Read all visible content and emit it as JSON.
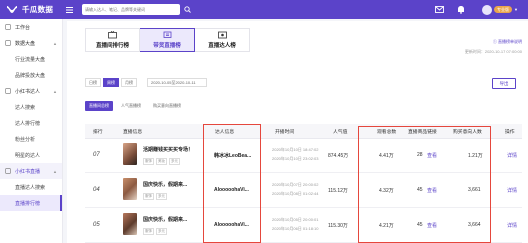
{
  "app": {
    "name": "千瓜数据"
  },
  "search": {
    "placeholder": "请输入达人、笔记、品牌等关键词"
  },
  "topbar": {
    "badge": "2",
    "vip_label": "专业版"
  },
  "sidebar": {
    "items": [
      {
        "type": "head",
        "label": "工作台",
        "icon": "home-icon"
      },
      {
        "type": "head",
        "label": "数据大盘",
        "icon": "dashboard-icon",
        "open": true
      },
      {
        "type": "item",
        "label": "行业流量大盘"
      },
      {
        "type": "item",
        "label": "品牌投放大盘"
      },
      {
        "type": "head",
        "label": "小红书达人",
        "icon": "user-icon",
        "open": true
      },
      {
        "type": "item",
        "label": "达人搜索"
      },
      {
        "type": "item",
        "label": "达人排行榜"
      },
      {
        "type": "item",
        "label": "粉丝分析"
      },
      {
        "type": "item",
        "label": "明星的达人"
      },
      {
        "type": "head",
        "label": "小红书直播",
        "icon": "live-icon",
        "open": true,
        "active": true
      },
      {
        "type": "item",
        "label": "直播达人搜索"
      },
      {
        "type": "item",
        "label": "直播排行榜",
        "active": true
      }
    ]
  },
  "tabs": [
    {
      "label": "直播间排行榜",
      "icon": "tv-icon",
      "active": false
    },
    {
      "label": "带货直播榜",
      "icon": "cart-icon",
      "active": true
    },
    {
      "label": "直播达人榜",
      "icon": "crown-icon",
      "active": false
    }
  ],
  "note": "① 直播榜单说明",
  "updated": "更新时间：2020-10-17 07:00:00",
  "filters": [
    {
      "label": "日榜",
      "active": false
    },
    {
      "label": "周榜",
      "active": true
    },
    {
      "label": "月榜",
      "active": false
    }
  ],
  "daterange": "2020-10-05至2020-10-11",
  "export_label": "导出",
  "subtabs": [
    {
      "label": "直播间总榜",
      "active": true
    },
    {
      "label": "人气直播榜",
      "active": false
    },
    {
      "label": "购买意向直播榜",
      "active": false
    }
  ],
  "table": {
    "headers": [
      "排行",
      "直播信息",
      "达人信息",
      "开播时间",
      "人气值",
      "观看总数",
      "直播商品链接",
      "购买意向人数",
      "操作"
    ],
    "rows": [
      {
        "rank": "07",
        "title": "活期赚钱买买买专场！",
        "tags": [
          "服饰",
          "美妆",
          "多元"
        ],
        "anchor": "韩冰冰LeoBea...",
        "time1": "2020年10月10日 18:47:02",
        "time2": "2020年10月10日 23:02:03",
        "popularity": "874.45万",
        "views": "4.41万",
        "goods_count": "28",
        "goods_link": "查看",
        "intent": "1.21万",
        "action": "详情"
      },
      {
        "rank": "04",
        "title": "国庆快乐，假期来...",
        "tags": [
          "服饰",
          "多元"
        ],
        "anchor": "AlooooohaVi...",
        "time1": "2020年10月07日 20:00:02",
        "time2": "2020年10月08日 01:02:44",
        "popularity": "115.12万",
        "views": "4.32万",
        "goods_count": "45",
        "goods_link": "查看",
        "intent": "3,661",
        "action": "详情"
      },
      {
        "rank": "05",
        "title": "国庆快乐，假期来...",
        "tags": [
          "服饰",
          "多元"
        ],
        "anchor": "AlooooohaVi...",
        "time1": "2020年10月05日 20:00:01",
        "time2": "2020年10月06日 01:18:10",
        "popularity": "115.30万",
        "views": "4.21万",
        "goods_count": "45",
        "goods_link": "查看",
        "intent": "3,664",
        "action": "详情"
      }
    ]
  },
  "colors": {
    "brand": "#5b43c9",
    "highlight_box": "#e5473d"
  }
}
